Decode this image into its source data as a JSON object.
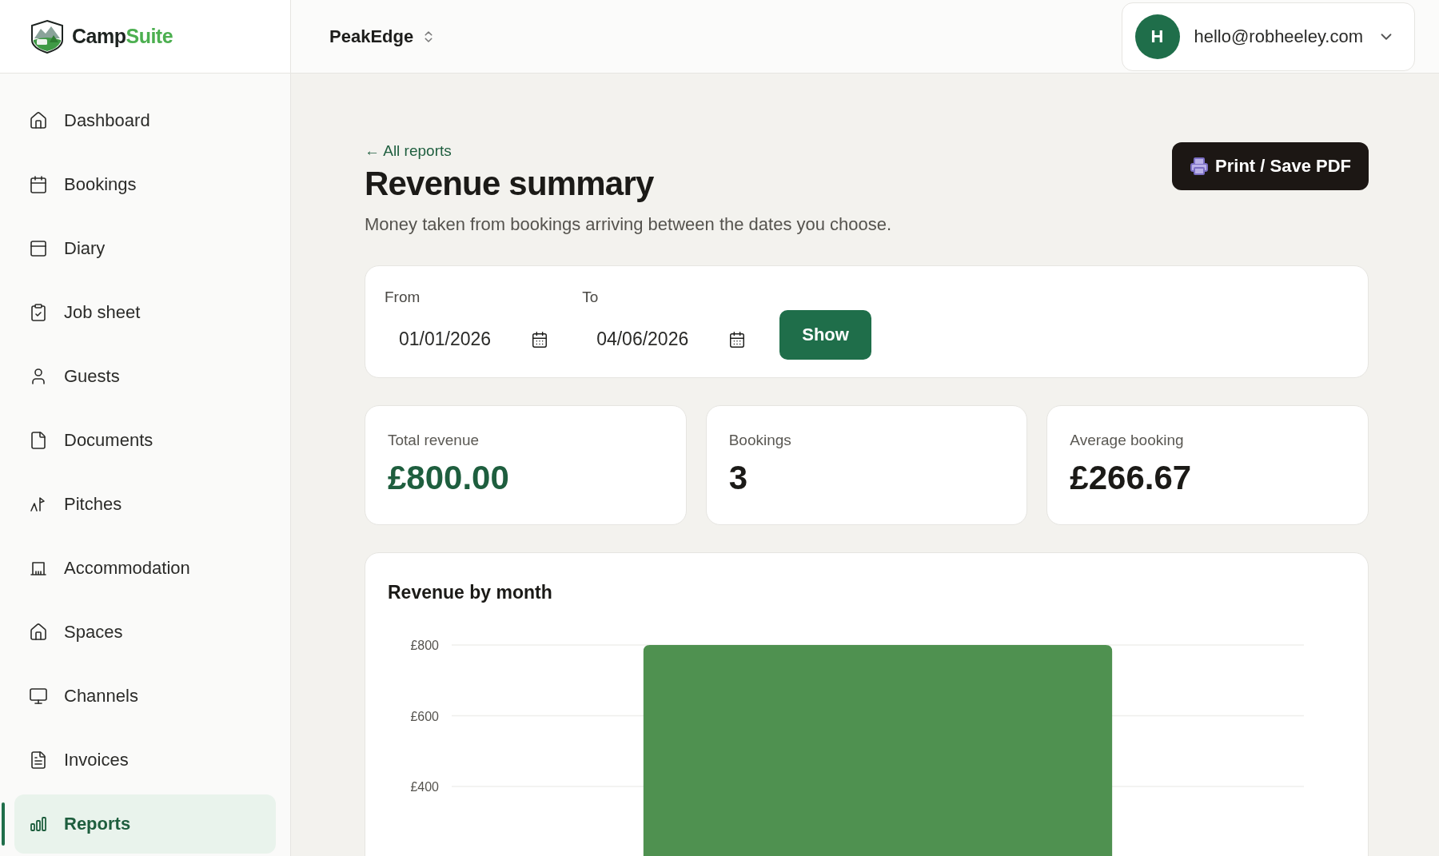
{
  "brand": {
    "name_parts": [
      "Camp",
      "Suite"
    ]
  },
  "org_switcher": {
    "label": "PeakEdge"
  },
  "user_menu": {
    "avatar": "H",
    "email": "hello@robheeley.com"
  },
  "sidebar": {
    "items": [
      {
        "label": "Dashboard",
        "selected": false
      },
      {
        "label": "Bookings",
        "selected": false
      },
      {
        "label": "Diary",
        "selected": false
      },
      {
        "label": "Job sheet",
        "selected": false
      },
      {
        "label": "Guests",
        "selected": false
      },
      {
        "label": "Documents",
        "selected": false
      },
      {
        "label": "Pitches",
        "selected": false
      },
      {
        "label": "Accommodation",
        "selected": false
      },
      {
        "label": "Spaces",
        "selected": false
      },
      {
        "label": "Channels",
        "selected": false
      },
      {
        "label": "Invoices",
        "selected": false
      },
      {
        "label": "Reports",
        "selected": true
      }
    ]
  },
  "page": {
    "back_link": "← All reports",
    "title": "Revenue summary",
    "subtitle": "Money taken from bookings arriving between the dates you choose.",
    "print_button": "Print / Save PDF"
  },
  "filters": {
    "from": {
      "label": "From",
      "value": "01/01/2026"
    },
    "to": {
      "label": "To",
      "value": "04/06/2026"
    },
    "button": "Show"
  },
  "stats": [
    {
      "label": "Total revenue",
      "value": "£800.00",
      "kind": "accent"
    },
    {
      "label": "Bookings",
      "value": "3",
      "kind": "plain"
    },
    {
      "label": "Average booking",
      "value": "£266.67",
      "kind": "plain"
    }
  ],
  "revenue_chart": {
    "title": "Revenue by month",
    "chart_data": {
      "type": "bar",
      "ylim": [
        0,
        800
      ],
      "yticks": [
        {
          "value": 400,
          "label": "£400"
        },
        {
          "value": 600,
          "label": "£600"
        },
        {
          "value": 800,
          "label": "£800"
        }
      ],
      "series": [
        {
          "color": "#4f9150",
          "values": [
            800
          ]
        }
      ]
    }
  }
}
